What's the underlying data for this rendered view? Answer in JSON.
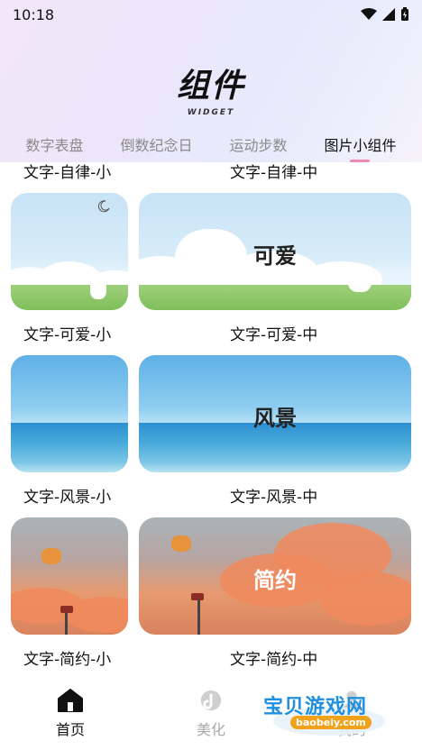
{
  "status": {
    "time": "10:18"
  },
  "header": {
    "title": "组件",
    "subtitle": "WIDGET"
  },
  "tabs": [
    {
      "label": "数字表盘"
    },
    {
      "label": "倒数纪念日"
    },
    {
      "label": "运动步数"
    },
    {
      "label": "图片小组件",
      "active": true
    }
  ],
  "rows": [
    {
      "small_label": "文字-自律-小",
      "medium_label": "文字-自律-中"
    },
    {
      "small_label": "文字-可爱-小",
      "medium_label": "文字-可爱-中",
      "card_text": "可爱"
    },
    {
      "small_label": "文字-风景-小",
      "medium_label": "文字-风景-中",
      "card_text": "风景"
    },
    {
      "small_label": "文字-简约-小",
      "medium_label": "文字-简约-中",
      "card_text": "简约"
    }
  ],
  "nav": [
    {
      "label": "首页",
      "icon": "home-icon",
      "active": true
    },
    {
      "label": "美化",
      "icon": "theme-icon",
      "active": false
    },
    {
      "label": "我的",
      "icon": "profile-icon",
      "active": false
    }
  ],
  "watermark": {
    "text": "宝贝游戏网",
    "url_text": "baobeiy.com"
  },
  "colors": {
    "accent": "#f08ab5"
  }
}
